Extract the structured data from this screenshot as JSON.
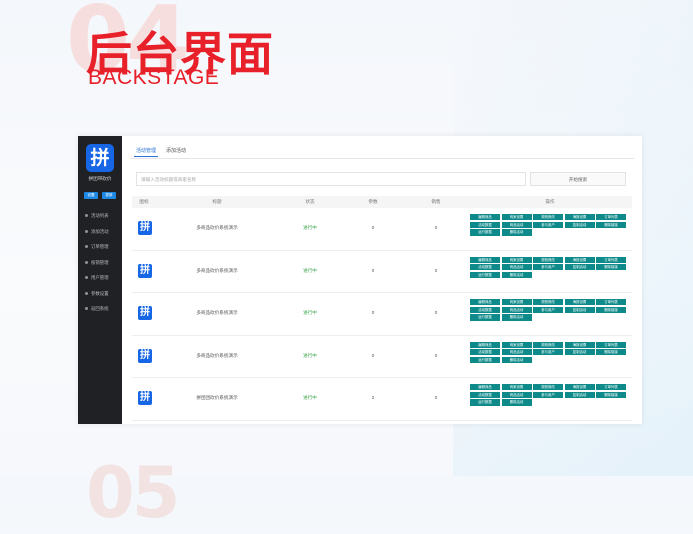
{
  "banner": {
    "number": "04",
    "title_cn": "后台界面",
    "title_en": "BACKSTAGE",
    "next_number": "05"
  },
  "colors": {
    "accent": "#e8202a",
    "sidebar": "#1f2124",
    "action": "#0f8a8a",
    "status_ok": "#3aa64c",
    "brand_blue": "#1766e6"
  },
  "app": {
    "logo_glyph": "拼",
    "brand_name": "拼团带砍价",
    "sidebar_buttons": [
      "设置",
      "更新"
    ],
    "menu": [
      "活动列表",
      "添加活动",
      "订单管理",
      "核销管理",
      "用户管理",
      "参数设置",
      "返回系统"
    ],
    "tabs": [
      "活动管理",
      "添加活动"
    ],
    "search": {
      "placeholder": "请输入活动标题或商家名称",
      "button": "开始搜索"
    },
    "columns": [
      "图标",
      "标题",
      "状态",
      "参数",
      "销售",
      "操作"
    ],
    "action_labels": [
      "编辑商品",
      "商家设置",
      "规则修改",
      "海报设置",
      "订单列表",
      "活动数据",
      "商品活动",
      "参与用户",
      "复制活动",
      "删除链接",
      "运行数据",
      "删除活动"
    ],
    "rows": [
      {
        "icon": "拼",
        "title": "多商品砍价系统演示",
        "status": "进行中",
        "params": "0",
        "sales": "0"
      },
      {
        "icon": "拼",
        "title": "多商品砍价系统演示",
        "status": "进行中",
        "params": "0",
        "sales": "0"
      },
      {
        "icon": "拼",
        "title": "多商品砍价系统演示",
        "status": "进行中",
        "params": "0",
        "sales": "0"
      },
      {
        "icon": "拼",
        "title": "多商品砍价系统演示",
        "status": "进行中",
        "params": "0",
        "sales": "0"
      },
      {
        "icon": "拼",
        "title": "拼团团砍价系统演示",
        "status": "进行中",
        "params": "2",
        "sales": "0"
      }
    ]
  }
}
